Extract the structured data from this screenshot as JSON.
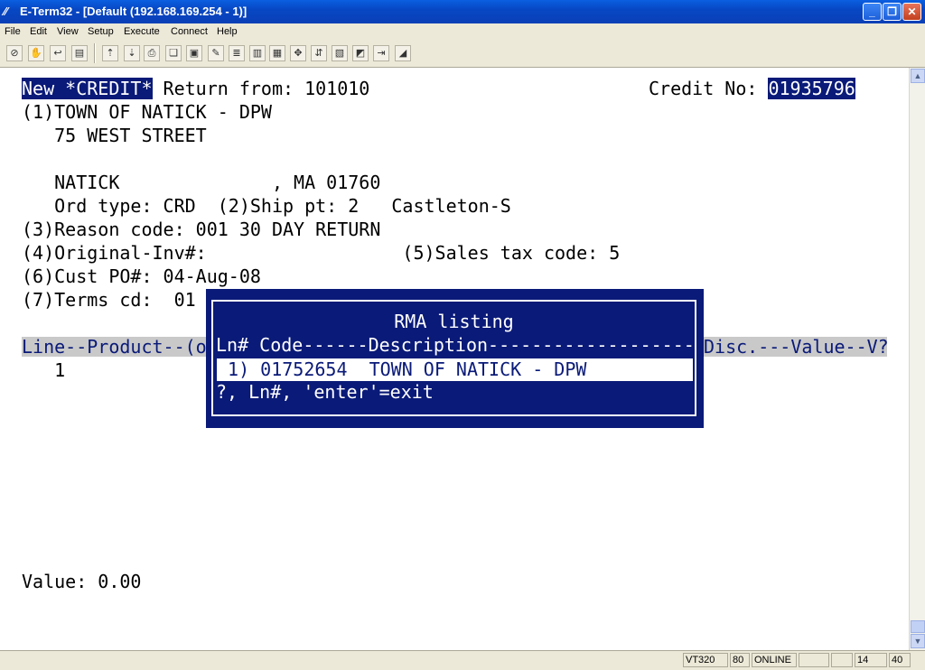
{
  "window": {
    "title": "E-Term32 - [Default (192.168.169.254 - 1)]"
  },
  "menu": [
    "File",
    "Edit",
    "View",
    "Setup",
    "Execute",
    "Connect",
    "Help"
  ],
  "toolbar_icons": [
    "disconnect-icon",
    "hand-icon",
    "connect-icon",
    "print-icon",
    "upload-icon",
    "download-icon",
    "printer-icon",
    "copy-icon",
    "paste-icon",
    "edit-icon",
    "document-icon",
    "columns-icon",
    "keypad-icon",
    "settings-icon",
    "transfer-icon",
    "capture-icon",
    "macro-icon",
    "exit-icon",
    "help-icon"
  ],
  "terminal": {
    "line1_highlight": "New *CREDIT*",
    "line1_text": " Return from: 101010",
    "credit_label": "Credit No: ",
    "credit_no": "01935796",
    "line2": "(1)TOWN OF NATICK - DPW",
    "line3": "   75 WEST STREET",
    "line5": "   NATICK              , MA 01760",
    "line6": "   Ord type: CRD  (2)Ship pt: 2   Castleton-S",
    "line7": "(3)Reason code: 001 30 DAY RETURN",
    "line8": "(4)Original-Inv#:                  (5)Sales tax code: 5",
    "line9": "(6)Cust PO#: 04-Aug-08",
    "line10": "(7)Terms cd:  01",
    "header_left": "Line--Product--(o",
    "header_right": "Disc.---Value--V?",
    "line_item": "   1",
    "value_line": "Value: 0.00"
  },
  "popup": {
    "title": "RMA listing",
    "columns": "Ln# Code------Description-------------------",
    "selected_row": " 1) 01752654  TOWN OF NATICK - DPW",
    "prompt": "?, Ln#, 'enter'=exit"
  },
  "status": {
    "emulation": "VT320",
    "cols": "80",
    "state": "ONLINE",
    "row": "14",
    "col": "40"
  },
  "colors": {
    "highlight": "#0a1a78",
    "header_bg": "#c9c9c9"
  }
}
